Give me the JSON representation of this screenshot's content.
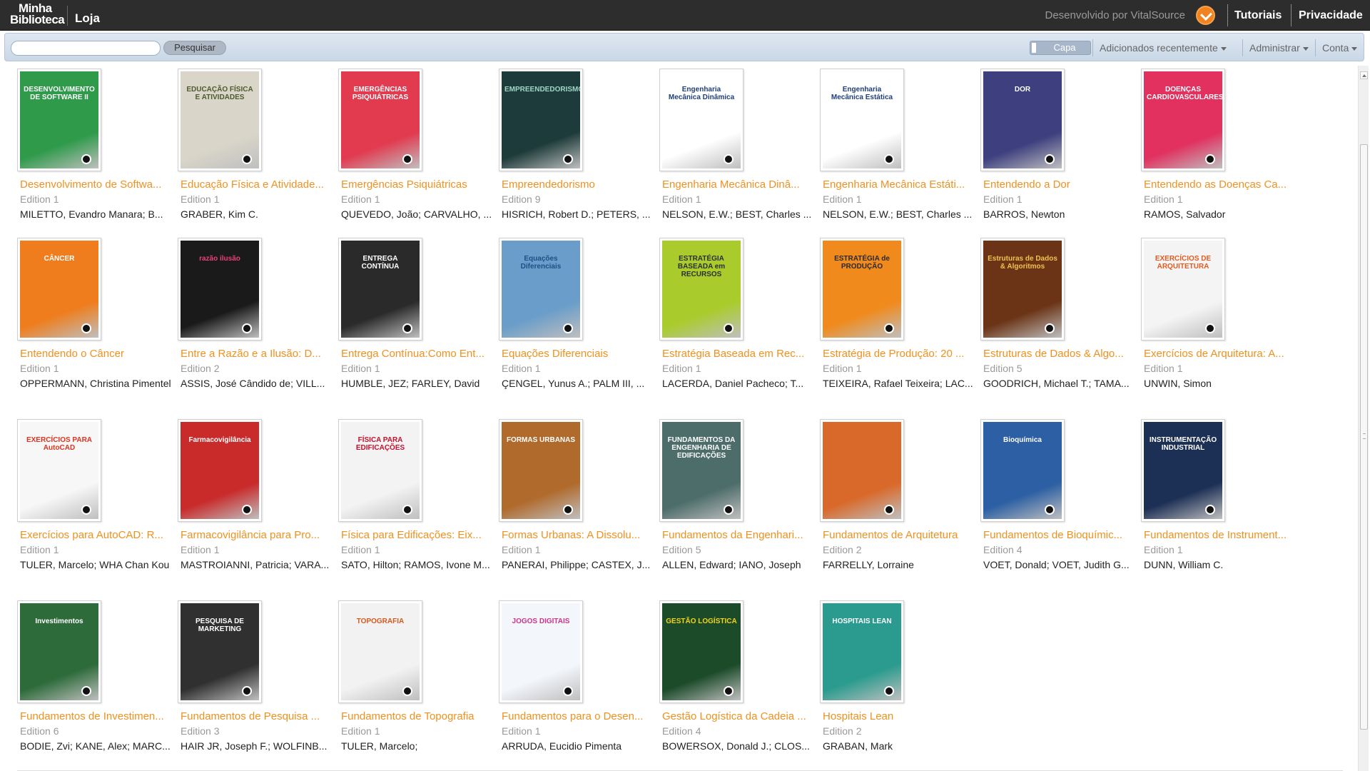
{
  "topbar": {
    "logo_line1": "Minha",
    "logo_line2": "Biblioteca",
    "store": "Loja",
    "powered_by": "Desenvolvido por VitalSource",
    "tutorials": "Tutoriais",
    "privacy": "Privacidade"
  },
  "toolbar": {
    "search_value": "",
    "search_button": "Pesquisar",
    "view_label": "Capa",
    "recent_menu": "Adicionados recentemente",
    "admin_menu": "Administrar",
    "account_menu": "Conta"
  },
  "books": [
    {
      "title": "Desenvolvimento de Softwa...",
      "edition": "Edition 1",
      "author": "MILETTO, Evandro Manara; B...",
      "cover_bg": "#2e9a4a",
      "cover_fg": "#ffffff",
      "cover_text": "DESENVOLVIMENTO DE SOFTWARE II"
    },
    {
      "title": "Educação Física e Atividade...",
      "edition": "Edition 1",
      "author": "GRABER, Kim C.",
      "cover_bg": "#d9d6c9",
      "cover_fg": "#4f5a2f",
      "cover_text": "EDUCAÇÃO FÍSICA E ATIVIDADES"
    },
    {
      "title": "Emergências Psiquiátricas",
      "edition": "Edition 1",
      "author": "QUEVEDO, João; CARVALHO, ...",
      "cover_bg": "#e23a4f",
      "cover_fg": "#ffffff",
      "cover_text": "EMERGÊNCIAS PSIQUIÁTRICAS"
    },
    {
      "title": "Empreendedorismo",
      "edition": "Edition 9",
      "author": "HISRICH, Robert D.; PETERS, ...",
      "cover_bg": "#1d3b3a",
      "cover_fg": "#9fd6c8",
      "cover_text": "EMPREENDEDORISMO"
    },
    {
      "title": "Engenharia Mecânica Dinâ...",
      "edition": "Edition 1",
      "author": "NELSON, E.W.; BEST, Charles ...",
      "cover_bg": "#ffffff",
      "cover_fg": "#1f3f7a",
      "cover_text": "Engenharia Mecânica Dinâmica"
    },
    {
      "title": "Engenharia Mecânica Estáti...",
      "edition": "Edition 1",
      "author": "NELSON, E.W.; BEST, Charles ...",
      "cover_bg": "#ffffff",
      "cover_fg": "#1f3f7a",
      "cover_text": "Engenharia Mecânica Estática"
    },
    {
      "title": "Entendendo a Dor",
      "edition": "Edition 1",
      "author": "BARROS, Newton",
      "cover_bg": "#3d3f7f",
      "cover_fg": "#ffffff",
      "cover_text": "DOR"
    },
    {
      "title": "Entendendo as Doenças Ca...",
      "edition": "Edition 1",
      "author": "RAMOS, Salvador",
      "cover_bg": "#e2305f",
      "cover_fg": "#ffffff",
      "cover_text": "DOENÇAS CARDIOVASCULARES"
    },
    {
      "title": "Entendendo o Câncer",
      "edition": "Edition 1",
      "author": "OPPERMANN, Christina Pimentel",
      "cover_bg": "#ef7d1d",
      "cover_fg": "#ffffff",
      "cover_text": "CÂNCER"
    },
    {
      "title": "Entre a Razão e a Ilusão: D...",
      "edition": "Edition 2",
      "author": "ASSIS, José Cândido de; VILL...",
      "cover_bg": "#1a1a1a",
      "cover_fg": "#e8417a",
      "cover_text": "razão ilusão"
    },
    {
      "title": "Entrega Contínua:Como Ent...",
      "edition": "Edition 1",
      "author": "HUMBLE, JEZ; FARLEY, David",
      "cover_bg": "#2a2a2a",
      "cover_fg": "#ffffff",
      "cover_text": "ENTREGA CONTÍNUA"
    },
    {
      "title": "Equações Diferenciais",
      "edition": "Edition 1",
      "author": "ÇENGEL, Yunus A.; PALM III, ...",
      "cover_bg": "#6a9dc9",
      "cover_fg": "#1e4f86",
      "cover_text": "Equações Diferenciais"
    },
    {
      "title": "Estratégia Baseada em Rec...",
      "edition": "Edition 1",
      "author": "LACERDA, Daniel Pacheco; T...",
      "cover_bg": "#a9cc2c",
      "cover_fg": "#2e2e2e",
      "cover_text": "ESTRATÉGIA BASEADA em RECURSOS"
    },
    {
      "title": "Estratégia de Produção: 20 ...",
      "edition": "Edition 1",
      "author": "TEIXEIRA, Rafael Teixeira; LAC...",
      "cover_bg": "#f08a1c",
      "cover_fg": "#2a2a2a",
      "cover_text": "ESTRATÉGIA de PRODUÇÃO"
    },
    {
      "title": "Estruturas de Dados & Algo...",
      "edition": "Edition 5",
      "author": "GOODRICH, Michael T.; TAMA...",
      "cover_bg": "#6b3416",
      "cover_fg": "#f2c14e",
      "cover_text": "Estruturas de Dados & Algoritmos"
    },
    {
      "title": "Exercícios de Arquitetura: A...",
      "edition": "Edition 1",
      "author": "UNWIN, Simon",
      "cover_bg": "#f4f4f4",
      "cover_fg": "#e55b1f",
      "cover_text": "EXERCÍCIOS DE ARQUITETURA"
    },
    {
      "title": "Exercícios para AutoCAD: R...",
      "edition": "Edition 1",
      "author": "TULER, Marcelo; WHA Chan Kou",
      "cover_bg": "#f7f7f7",
      "cover_fg": "#e0331f",
      "cover_text": "EXERCÍCIOS PARA AutoCAD"
    },
    {
      "title": "Farmacovigilância para Pro...",
      "edition": "Edition 1",
      "author": "MASTROIANNI, Patricia; VARA...",
      "cover_bg": "#c92a2a",
      "cover_fg": "#ffffff",
      "cover_text": "Farmacovigilância"
    },
    {
      "title": "Física para Edificações: Eix...",
      "edition": "Edition 1",
      "author": "SATO, Hilton; RAMOS, Ivone M...",
      "cover_bg": "#f3f3f3",
      "cover_fg": "#c8102e",
      "cover_text": "FÍSICA PARA EDIFICAÇÕES"
    },
    {
      "title": "Formas Urbanas: A Dissolu...",
      "edition": "Edition 1",
      "author": "PANERAI, Philippe; CASTEX, J...",
      "cover_bg": "#b06a2c",
      "cover_fg": "#ffffff",
      "cover_text": "FORMAS URBANAS"
    },
    {
      "title": "Fundamentos da Engenhari...",
      "edition": "Edition 5",
      "author": "ALLEN, Edward; IANO, Joseph",
      "cover_bg": "#4d6d6a",
      "cover_fg": "#ffffff",
      "cover_text": "FUNDAMENTOS DA ENGENHARIA DE EDIFICAÇÕES"
    },
    {
      "title": "Fundamentos de Arquitetura",
      "edition": "Edition 2",
      "author": "FARRELLY, Lorraine",
      "cover_bg": "#d9692a",
      "cover_fg": "#ffffff",
      "cover_text": ""
    },
    {
      "title": "Fundamentos de Bioquímic...",
      "edition": "Edition 4",
      "author": "VOET, Donald; VOET, Judith G...",
      "cover_bg": "#2c5fa3",
      "cover_fg": "#ffffff",
      "cover_text": "Bioquímica"
    },
    {
      "title": "Fundamentos de Instrument...",
      "edition": "Edition 1",
      "author": "DUNN, William C.",
      "cover_bg": "#1c2f55",
      "cover_fg": "#ffffff",
      "cover_text": "INSTRUMENTAÇÃO INDUSTRIAL"
    },
    {
      "title": "Fundamentos de Investimen...",
      "edition": "Edition 6",
      "author": "BODIE, Zvi; KANE, Alex; MARC...",
      "cover_bg": "#2d6b3a",
      "cover_fg": "#ffffff",
      "cover_text": "Investimentos"
    },
    {
      "title": "Fundamentos de Pesquisa ...",
      "edition": "Edition 3",
      "author": "HAIR JR, Joseph F.; WOLFINB...",
      "cover_bg": "#303030",
      "cover_fg": "#ffffff",
      "cover_text": "PESQUISA DE MARKETING"
    },
    {
      "title": "Fundamentos de Topografia",
      "edition": "Edition 1",
      "author": "TULER, Marcelo;",
      "cover_bg": "#f2f2f2",
      "cover_fg": "#d6591c",
      "cover_text": "TOPOGRAFIA"
    },
    {
      "title": "Fundamentos para o Desen...",
      "edition": "Edition 1",
      "author": "ARRUDA, Eucidio Pimenta",
      "cover_bg": "#f3f6fb",
      "cover_fg": "#d0338a",
      "cover_text": "JOGOS DIGITAIS"
    },
    {
      "title": "Gestão Logística da Cadeia ...",
      "edition": "Edition 4",
      "author": "BOWERSOX, Donald J.; CLOS...",
      "cover_bg": "#1c4b2a",
      "cover_fg": "#f2d41c",
      "cover_text": "GESTÃO LOGÍSTICA"
    },
    {
      "title": "Hospitais Lean",
      "edition": "Edition 2",
      "author": "GRABAN, Mark",
      "cover_bg": "#2a9b8e",
      "cover_fg": "#ffffff",
      "cover_text": "HOSPITAIS LEAN"
    }
  ]
}
